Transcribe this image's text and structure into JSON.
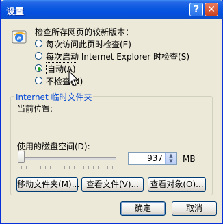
{
  "window": {
    "title": "设置"
  },
  "titlebar": {
    "help": "?",
    "close": "✕"
  },
  "check": {
    "caption": "检查所存网页的较新版本：",
    "options": [
      "每次访问此页时检查(E)",
      "每次启动 Internet Explorer 时检查(S)",
      "自动(A)",
      "不检查(N)"
    ],
    "selected_index": 2
  },
  "temp": {
    "legend": "Internet 临时文件夹",
    "current_location": "当前位置:",
    "disk_label": "使用的磁盘空间(D):",
    "disk_value": "937",
    "unit": "MB",
    "slider_fraction": 0.02,
    "buttons": {
      "move": "移动文件夹(M)...",
      "view_files": "查看文件(V)...",
      "view_objects": "查看对象(O)..."
    }
  },
  "footer": {
    "ok": "确定",
    "cancel": "取消"
  },
  "icons": {
    "ie": "ie-icon",
    "help": "help-icon",
    "close": "close-icon",
    "cursor": "mouse-cursor-icon"
  },
  "colors": {
    "title_bar": "#0a58e0",
    "face": "#ece9d8",
    "legend": "#0046d5"
  }
}
